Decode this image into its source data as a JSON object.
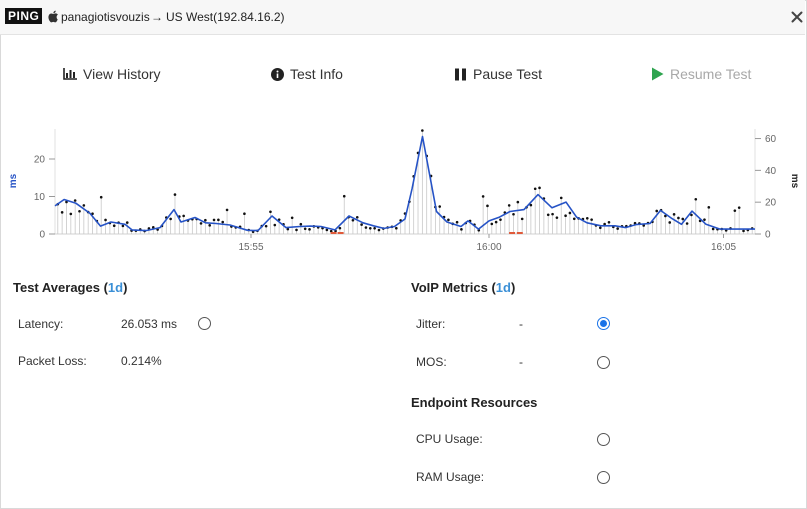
{
  "titlebar": {
    "badge": "PING",
    "apple_icon": "apple-icon",
    "host": "panagiotisvouzis",
    "arrow": "→",
    "destination": "US West(192.84.16.2)",
    "close_icon": "close-icon"
  },
  "toolbar": {
    "view_history": {
      "label": "View History",
      "icon": "bar-chart-icon"
    },
    "test_info": {
      "label": "Test Info",
      "icon": "info-icon"
    },
    "pause_test": {
      "label": "Pause Test",
      "icon": "pause-icon"
    },
    "resume_test": {
      "label": "Resume Test",
      "icon": "play-icon",
      "disabled": true
    }
  },
  "chart_data": {
    "type": "line",
    "ylabel_left": "ms",
    "ylabel_right": "ms",
    "left_ticks": [
      0,
      10,
      20
    ],
    "right_ticks": [
      0,
      20,
      40,
      60
    ],
    "ylim_left": [
      0,
      28
    ],
    "ylim_right": [
      0,
      66
    ],
    "xlim": [
      0,
      100
    ],
    "x_ticks": [
      {
        "x": 28,
        "label": "15:55"
      },
      {
        "x": 62,
        "label": "16:00"
      },
      {
        "x": 95.5,
        "label": "16:05"
      }
    ],
    "line_color": "#2653c6",
    "loss_color": "#e05a3a",
    "series": [
      {
        "values_left_axis": [
          [
            0,
            7.5
          ],
          [
            1.3,
            9.2
          ],
          [
            3,
            8.2
          ],
          [
            5,
            5.5
          ],
          [
            6.5,
            2.1
          ],
          [
            8,
            3.2
          ],
          [
            10,
            2.6
          ],
          [
            11,
            1.1
          ],
          [
            13,
            0.9
          ],
          [
            15,
            1.7
          ],
          [
            17,
            6.5
          ],
          [
            18,
            3.2
          ],
          [
            20,
            4.4
          ],
          [
            21.5,
            3.0
          ],
          [
            23,
            2.8
          ],
          [
            25,
            2.4
          ],
          [
            27.5,
            1.0
          ],
          [
            29,
            0.9
          ],
          [
            31,
            4.8
          ],
          [
            33,
            1.7
          ],
          [
            35,
            2.0
          ],
          [
            36.5,
            2.1
          ],
          [
            38,
            2.0
          ],
          [
            40,
            1.1
          ],
          [
            42,
            4.8
          ],
          [
            44,
            3.0
          ],
          [
            45.5,
            2.2
          ],
          [
            47,
            1.5
          ],
          [
            48.5,
            2.0
          ],
          [
            50,
            4.0
          ],
          [
            51,
            12.0
          ],
          [
            52.5,
            26.0
          ],
          [
            54.5,
            6.0
          ],
          [
            56,
            3.2
          ],
          [
            58,
            2.0
          ],
          [
            59,
            3.5
          ],
          [
            60.5,
            1.3
          ],
          [
            62,
            3.5
          ],
          [
            63.5,
            4.5
          ],
          [
            65,
            6.0
          ],
          [
            67,
            6.5
          ],
          [
            69,
            10.5
          ],
          [
            71,
            7.0
          ],
          [
            73,
            8.5
          ],
          [
            74.5,
            4.5
          ],
          [
            76,
            3.0
          ],
          [
            78,
            2.2
          ],
          [
            80,
            2.2
          ],
          [
            81.5,
            1.7
          ],
          [
            83,
            2.5
          ],
          [
            85,
            2.8
          ],
          [
            86.5,
            6.3
          ],
          [
            88,
            4.3
          ],
          [
            89.5,
            2.6
          ],
          [
            91,
            6.1
          ],
          [
            93,
            2.6
          ],
          [
            95,
            1.3
          ],
          [
            100,
            1.3
          ]
        ]
      }
    ],
    "loss_markers_x": [
      39.8,
      40.8,
      65.3,
      66.4
    ]
  },
  "averages": {
    "title": "Test Averages",
    "period": "(1d)",
    "period_open": "(",
    "period_value": "1d",
    "period_close": ")",
    "latency": {
      "label": "Latency:",
      "value": "26.053 ms",
      "selected": false
    },
    "packet_loss": {
      "label": "Packet Loss:",
      "value": "0.214%"
    }
  },
  "voip": {
    "title": "VoIP Metrics",
    "period_open": "(",
    "period_value": "1d",
    "period_close": ")",
    "jitter": {
      "label": "Jitter:",
      "value": "-",
      "selected": true
    },
    "mos": {
      "label": "MOS:",
      "value": "-",
      "selected": false
    }
  },
  "endpoint": {
    "title": "Endpoint Resources",
    "cpu": {
      "label": "CPU Usage:",
      "selected": false
    },
    "ram": {
      "label": "RAM Usage:",
      "selected": false
    }
  }
}
